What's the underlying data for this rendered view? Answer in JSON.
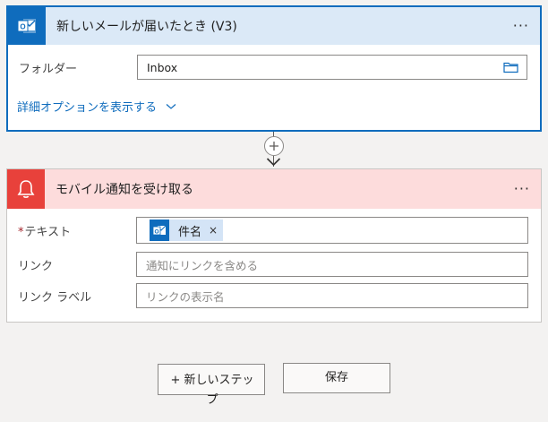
{
  "trigger": {
    "title": "新しいメールが届いたとき (V3)",
    "more": "···",
    "icon": "outlook-icon",
    "folder_label": "フォルダー",
    "folder_value": "Inbox",
    "advanced_link": "詳細オプションを表示する",
    "accent_color": "#0f6cbd"
  },
  "action": {
    "title": "モバイル通知を受け取る",
    "more": "···",
    "icon": "bell-icon",
    "accent_color": "#e8413b",
    "text_label": "テキスト",
    "required_mark": "*",
    "token_label": "件名",
    "token_remove": "×",
    "link_label": "リンク",
    "link_placeholder": "通知にリンクを含める",
    "link_label_label": "リンク ラベル",
    "link_label_placeholder": "リンクの表示名"
  },
  "footer": {
    "new_step_line1": "+ 新しいステッ",
    "new_step_line2": "プ",
    "save_label": "保存"
  }
}
